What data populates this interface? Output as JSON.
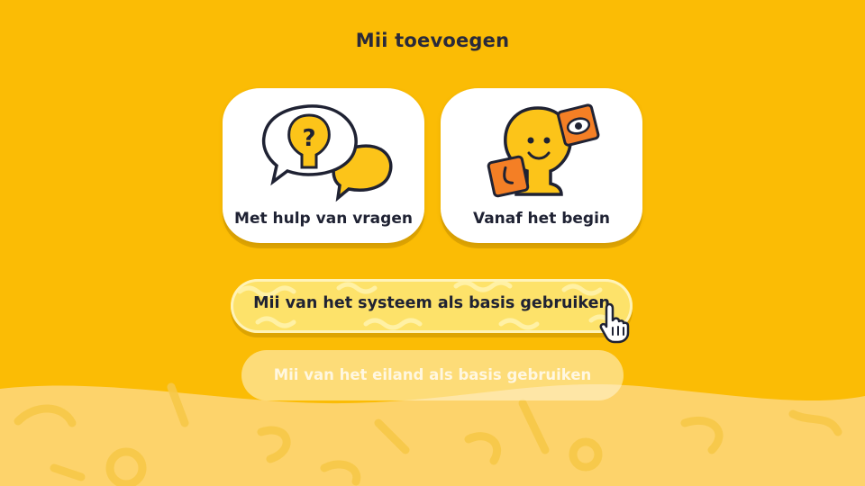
{
  "screen": {
    "title": "Mii toevoegen",
    "colors": {
      "background": "#fbbc05",
      "text": "#1f2233",
      "accent": "#ffcc00"
    }
  },
  "options": [
    {
      "label": "Met hulp van vragen",
      "icon": "question-speech-bubbles-icon"
    },
    {
      "label": "Vanaf het begin",
      "icon": "mii-face-parts-icon"
    }
  ],
  "buttons": {
    "system_base": "Mii van het systeem als basis gebruiken",
    "island_base": "Mii van het eiland als basis gebruiken"
  },
  "cursor": {
    "icon": "hand-pointer-icon"
  }
}
